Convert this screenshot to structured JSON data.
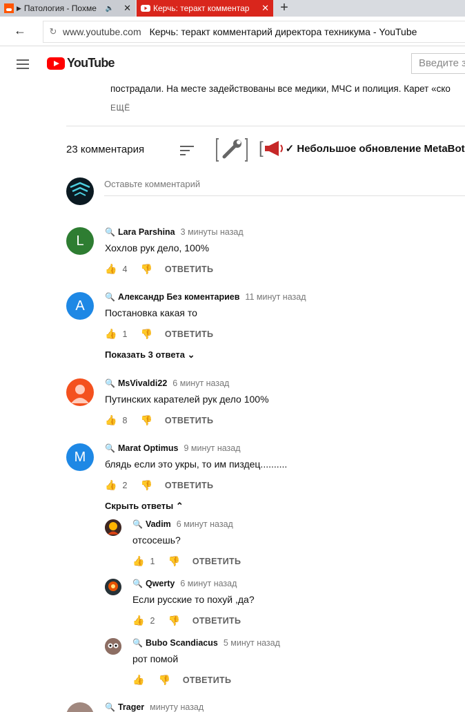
{
  "browser": {
    "tabs": [
      {
        "title": "Патология - Похме",
        "active": false
      },
      {
        "title": "Керчь: теракт комментар",
        "active": true
      }
    ],
    "new_tab_icon": "plus-icon",
    "address": {
      "domain": "www.youtube.com",
      "page_title": "Керчь: теракт комментарий директора техникума - YouTube"
    }
  },
  "youtube": {
    "logo_text": "YouTube",
    "search_placeholder": "Введите з",
    "description_line": "пострадали. На месте задействованы все медики, МЧС и полиция. Карет «ско",
    "more_label": "ЕЩЁ",
    "comments_count": "23 комментария",
    "metabot_text": "✓ Небольшое обновление MetaBot о",
    "add_comment_placeholder": "Оставьте комментарий",
    "reply_label": "ОТВЕТИТЬ"
  },
  "comments": [
    {
      "author": "Lara Parshina",
      "time": "3 минуты назад",
      "text": "Хохлов рук дело, 100%",
      "likes": "4",
      "avatar_letter": "L",
      "avatar_color": "#2e7d32"
    },
    {
      "author": "Александр Без коментариев",
      "time": "11 минут назад",
      "text": "Постановка какая то",
      "likes": "1",
      "avatar_letter": "A",
      "avatar_color": "#1e88e5",
      "toggle": "Показать 3 ответа"
    },
    {
      "author": "MsVivaldi22",
      "time": "6 минут назад",
      "text": "Путинских карателей рук дело 100%",
      "likes": "8",
      "avatar_color": "#f4511e"
    },
    {
      "author": "Marat Optimus",
      "time": "9 минут назад",
      "text": "блядь если это укры, то им пиздец..........",
      "likes": "2",
      "avatar_letter": "M",
      "avatar_color": "#1e88e5",
      "toggle": "Скрыть ответы"
    }
  ],
  "replies": [
    {
      "author": "Vadim",
      "time": "6 минут назад",
      "text": "отсосешь?",
      "likes": "1"
    },
    {
      "author": "Qwerty",
      "time": "6 минут назад",
      "text": "Если русские то похуй ,да?",
      "likes": "2"
    },
    {
      "author": "Bubo Scandiacus",
      "time": "5 минут назад",
      "text": "рот помой",
      "likes": ""
    }
  ],
  "partial_comment": {
    "author": "Trager",
    "time": "минуту назад"
  }
}
